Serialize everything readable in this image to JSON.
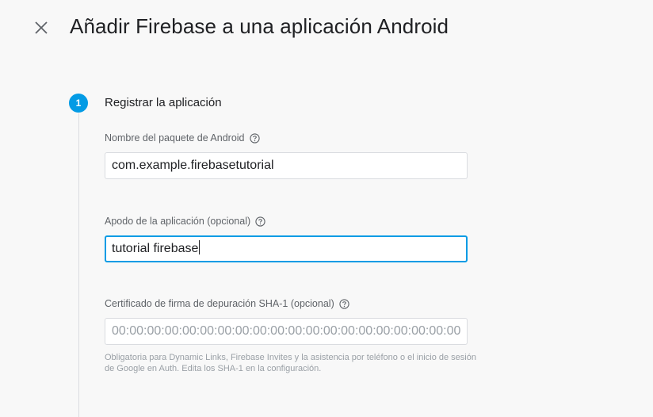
{
  "dialog": {
    "title": "Añadir Firebase a una aplicación Android",
    "close_icon": "close-icon"
  },
  "step": {
    "number": "1",
    "title": "Registrar la aplicación",
    "accent_color": "#039be5"
  },
  "fields": {
    "package_name": {
      "label": "Nombre del paquete de Android",
      "value": "com.example.firebasetutorial"
    },
    "app_nickname": {
      "label": "Apodo de la aplicación (opcional)",
      "value": "tutorial firebase"
    },
    "sha1": {
      "label": "Certificado de firma de depuración SHA-1 (opcional)",
      "value": "",
      "placeholder": "00:00:00:00:00:00:00:00:00:00:00:00:00:00:00:00:00:00:00:00",
      "hint": "Obligatoria para Dynamic Links, Firebase Invites y la asistencia por teléfono o el inicio de sesión de Google en Auth. Edita los SHA-1 en la configuración."
    }
  }
}
